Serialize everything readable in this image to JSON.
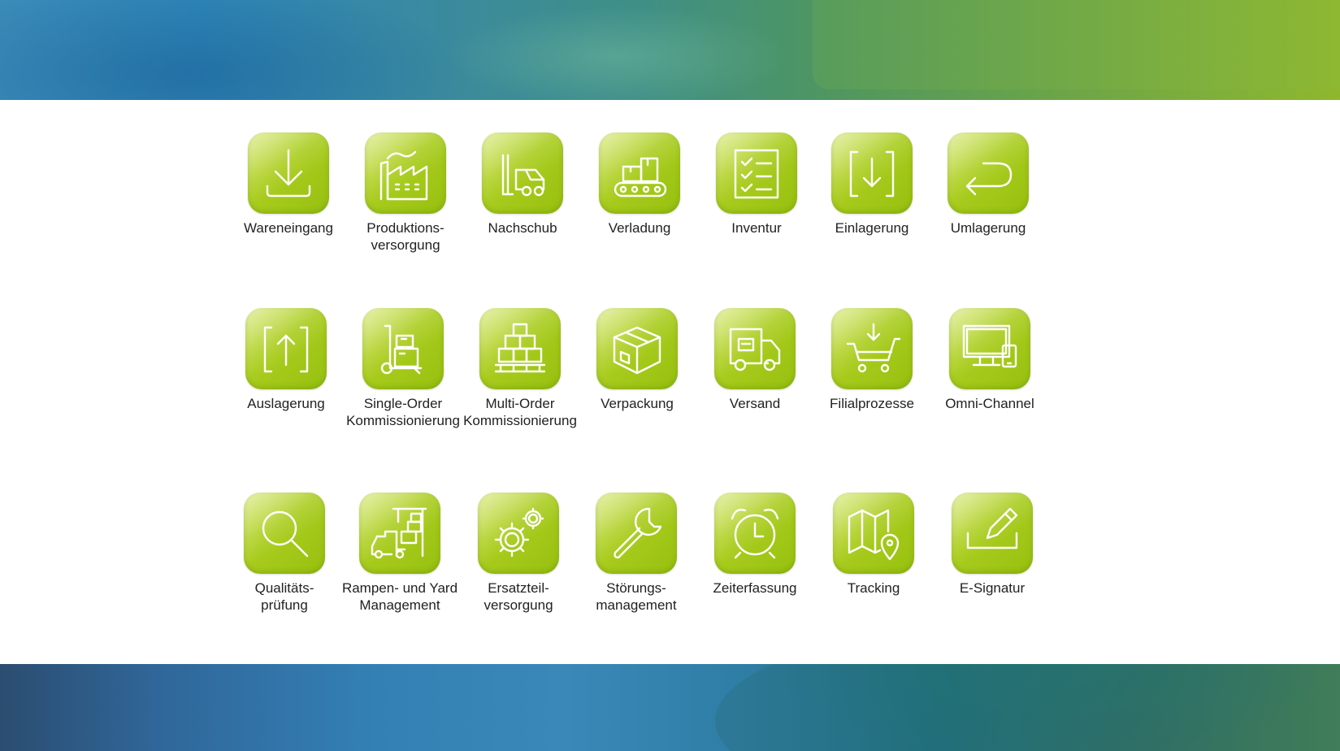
{
  "colors": {
    "tile_light": "#c9e04a",
    "tile_dark": "#97c00f",
    "icon_stroke": "#ffffff",
    "label_text": "#222222",
    "banner_blue": "#2e86b8",
    "banner_green": "#8fb72e"
  },
  "rows": [
    {
      "items": [
        {
          "label": "Wareneingang",
          "icon": "download-tray-icon"
        },
        {
          "label": "Produktions-\nversorgung",
          "icon": "factory-icon"
        },
        {
          "label": "Nachschub",
          "icon": "forklift-icon"
        },
        {
          "label": "Verladung",
          "icon": "conveyor-belt-icon"
        },
        {
          "label": "Inventur",
          "icon": "checklist-icon"
        },
        {
          "label": "Einlagerung",
          "icon": "bracket-arrow-down-icon"
        },
        {
          "label": "Umlagerung",
          "icon": "return-arrow-icon"
        }
      ]
    },
    {
      "items": [
        {
          "label": "Auslagerung",
          "icon": "bracket-arrow-up-icon"
        },
        {
          "label": "Single-Order\nKommissionierung",
          "icon": "hand-truck-icon"
        },
        {
          "label": "Multi-Order\nKommissionierung",
          "icon": "pallet-boxes-icon"
        },
        {
          "label": "Verpackung",
          "icon": "package-box-icon"
        },
        {
          "label": "Versand",
          "icon": "delivery-truck-icon"
        },
        {
          "label": "Filialprozesse",
          "icon": "shopping-cart-icon"
        },
        {
          "label": "Omni-Channel",
          "icon": "monitor-tablet-icon"
        }
      ]
    },
    {
      "items": [
        {
          "label": "Qualitäts-\nprüfung",
          "icon": "magnifier-icon"
        },
        {
          "label": "Rampen- und Yard\nManagement",
          "icon": "truck-crane-icon"
        },
        {
          "label": "Ersatzteil-\nversorgung",
          "icon": "gears-icon"
        },
        {
          "label": "Störungs-\nmanagement",
          "icon": "wrench-icon"
        },
        {
          "label": "Zeiterfassung",
          "icon": "alarm-clock-icon"
        },
        {
          "label": "Tracking",
          "icon": "map-pin-icon"
        },
        {
          "label": "E-Signatur",
          "icon": "pen-signature-icon"
        }
      ]
    }
  ]
}
